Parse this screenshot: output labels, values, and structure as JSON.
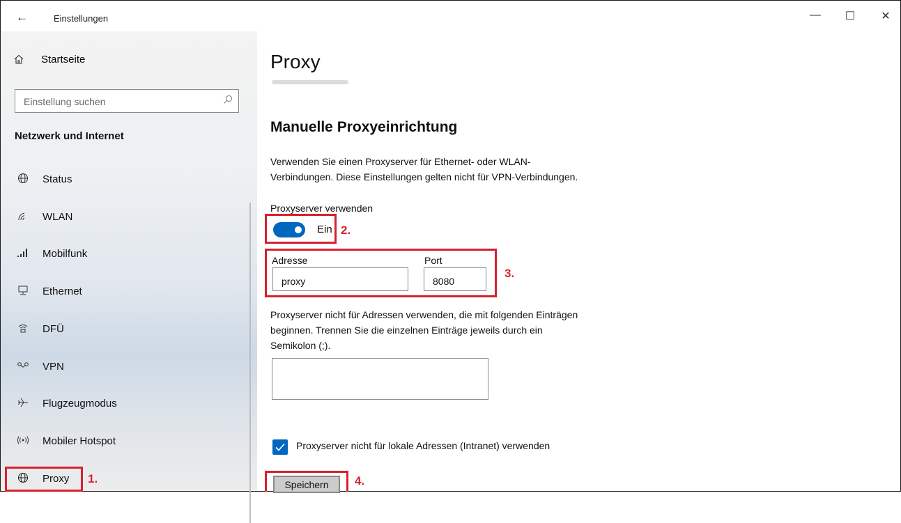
{
  "window": {
    "title": "Einstellungen",
    "back_glyph": "←",
    "minimize_glyph": "—",
    "maximize_glyph": "☐",
    "close_glyph": "✕"
  },
  "sidebar": {
    "home": {
      "icon": "home-icon",
      "label": "Startseite"
    },
    "search": {
      "placeholder": "Einstellung suchen",
      "icon": "search-icon"
    },
    "section_title": "Netzwerk und Internet",
    "items": [
      {
        "icon": "globe-status-icon",
        "label": "Status"
      },
      {
        "icon": "wifi-icon",
        "label": "WLAN"
      },
      {
        "icon": "cellular-signal-icon",
        "label": "Mobilfunk"
      },
      {
        "icon": "ethernet-icon",
        "label": "Ethernet"
      },
      {
        "icon": "dialup-icon",
        "label": "DFÜ"
      },
      {
        "icon": "vpn-icon",
        "label": "VPN"
      },
      {
        "icon": "airplane-icon",
        "label": "Flugzeugmodus"
      },
      {
        "icon": "hotspot-icon",
        "label": "Mobiler Hotspot"
      },
      {
        "icon": "globe-icon",
        "label": "Proxy"
      }
    ]
  },
  "main": {
    "title": "Proxy",
    "section_title": "Manuelle Proxyeinrichtung",
    "description_line1": "Verwenden Sie einen Proxyserver für Ethernet- oder WLAN-",
    "description_line2": "Verbindungen. Diese Einstellungen gelten nicht für VPN-Verbindungen.",
    "use_proxy_label": "Proxyserver verwenden",
    "toggle_state_label": "Ein",
    "toggle_on": true,
    "address_label": "Adresse",
    "address_value": "proxy",
    "port_label": "Port",
    "port_value": "8080",
    "exceptions_line1": "Proxyserver nicht für Adressen verwenden, die mit folgenden Einträgen",
    "exceptions_line2": "beginnen. Trennen Sie die einzelnen Einträge jeweils durch ein",
    "exceptions_line3": "Semikolon (;).",
    "exceptions_value": "",
    "local_checkbox_label": "Proxyserver nicht für lokale Adressen (Intranet) verwenden",
    "local_checkbox_checked": true,
    "save_label": "Speichern"
  },
  "annotations": {
    "step1": "1.",
    "step2": "2.",
    "step3": "3.",
    "step4": "4."
  },
  "colors": {
    "accent": "#0067c0",
    "highlight": "#d6202f"
  }
}
